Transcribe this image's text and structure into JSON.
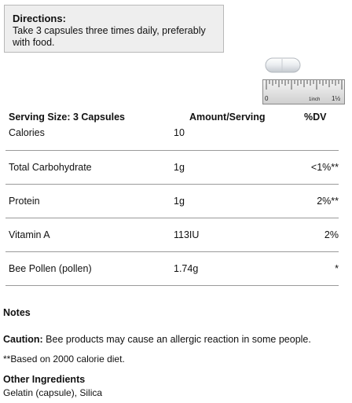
{
  "directions": {
    "title": "Directions:",
    "text": "Take 3 capsules three times daily, preferably with food."
  },
  "size_guide": {
    "capsule_icon": "capsule-icon",
    "ruler_icon": "ruler-icon",
    "ruler_zero": "0",
    "ruler_inch": "1inch",
    "ruler_one_half": "1½"
  },
  "facts": {
    "header": {
      "serving_size": "Serving Size: 3 Capsules",
      "amount": "Amount/Serving",
      "dv": "%DV"
    },
    "rows": [
      {
        "name": "Calories",
        "amount": "10",
        "dv": ""
      },
      {
        "name": "Total Carbohydrate",
        "amount": "1g",
        "dv": "<1%**"
      },
      {
        "name": "Protein",
        "amount": "1g",
        "dv": "2%**"
      },
      {
        "name": "Vitamin A",
        "amount": "113IU",
        "dv": "2%"
      },
      {
        "name": "Bee Pollen (pollen)",
        "amount": "1.74g",
        "dv": "*"
      }
    ]
  },
  "notes": {
    "title": "Notes",
    "caution_label": "Caution:",
    "caution_text": " Bee products may cause an allergic reaction in some people.",
    "footnote": "**Based on 2000 calorie diet."
  },
  "other_ingredients": {
    "title": "Other Ingredients",
    "text": "Gelatin (capsule), Silica"
  }
}
